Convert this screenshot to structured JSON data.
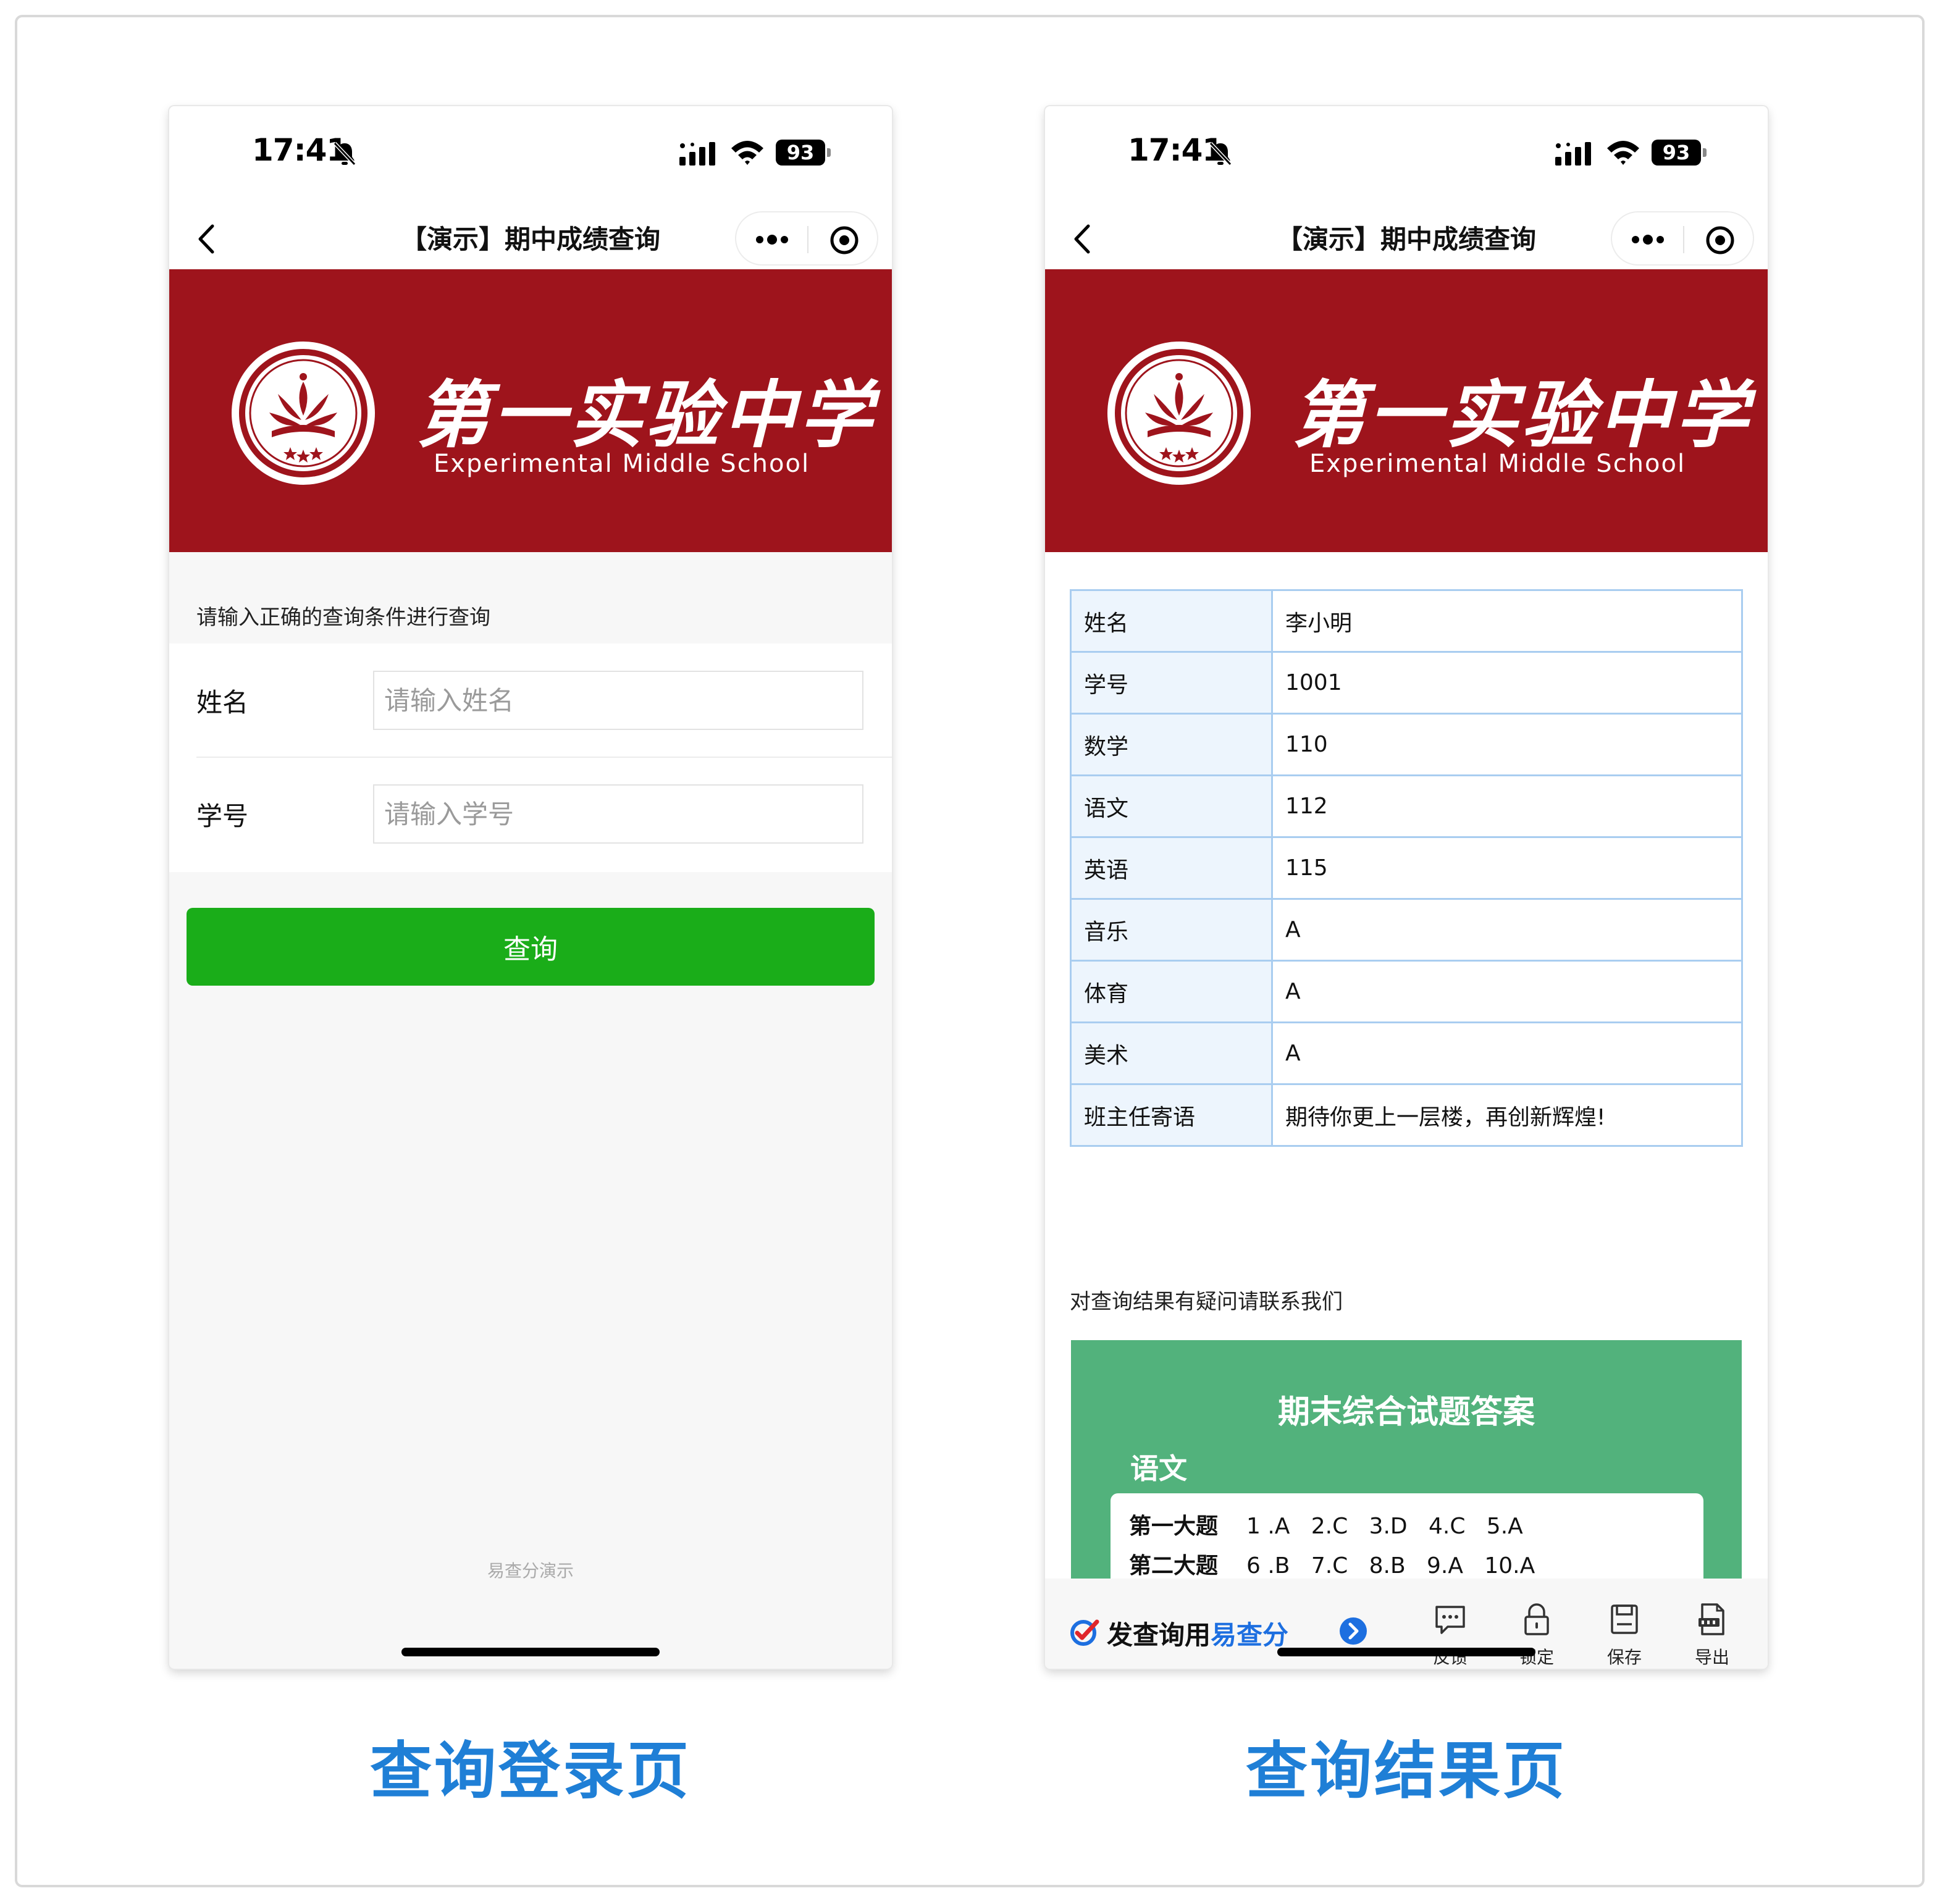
{
  "status": {
    "time": "17:41",
    "battery": "93"
  },
  "nav": {
    "title": "【演示】期中成绩查询"
  },
  "banner": {
    "school_cn": "第一实验中学",
    "school_en": "Experimental Middle School"
  },
  "login": {
    "hint": "请输入正确的查询条件进行查询",
    "name_label": "姓名",
    "name_placeholder": "请输入姓名",
    "id_label": "学号",
    "id_placeholder": "请输入学号",
    "query_button": "查询",
    "footer": "易查分演示"
  },
  "result": {
    "rows": [
      {
        "key": "姓名",
        "value": "李小明"
      },
      {
        "key": "学号",
        "value": "1001"
      },
      {
        "key": "数学",
        "value": "110"
      },
      {
        "key": "语文",
        "value": "112"
      },
      {
        "key": "英语",
        "value": "115"
      },
      {
        "key": "音乐",
        "value": "A"
      },
      {
        "key": "体育",
        "value": "A"
      },
      {
        "key": "美术",
        "value": "A"
      },
      {
        "key": "班主任寄语",
        "value": "期待你更上一层楼，再创新辉煌!"
      }
    ],
    "contact": "对查询结果有疑问请联系我们",
    "answer_card": {
      "title": "期末综合试题答案",
      "subject": "语文",
      "q1_label": "第一大题",
      "q1_answers": "1 .A   2.C   3.D   4.C   5.A",
      "q2_label": "第二大题",
      "q2_answers": "6 .B   7.C   8.B   9.A   10.A"
    },
    "brand": {
      "prefix": "发查询用",
      "highlight": "易查分"
    },
    "toolbar": {
      "feedback": "反馈",
      "lock": "锁定",
      "save": "保存",
      "export": "导出"
    }
  },
  "captions": {
    "left": "查询登录页",
    "right": "查询结果页"
  },
  "colors": {
    "banner": "#9e141c",
    "button": "#1aad19",
    "card": "#52b27c",
    "caption": "#1f7fd6",
    "table_border": "#a9cdf0"
  }
}
